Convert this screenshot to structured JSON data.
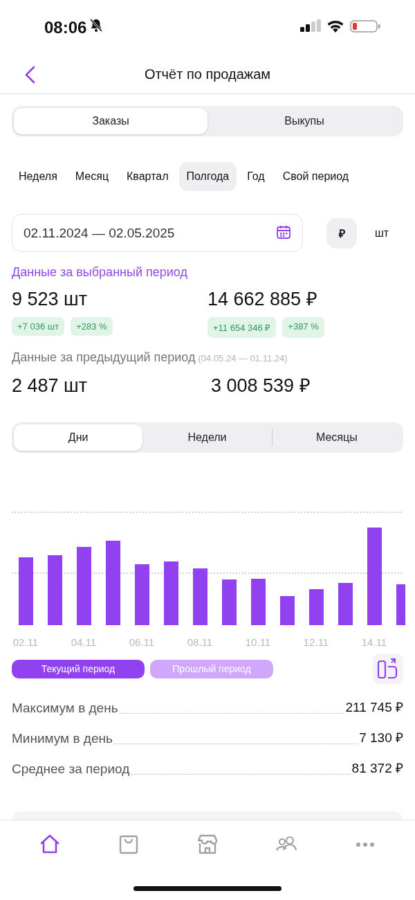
{
  "status_bar": {
    "time": "08:06"
  },
  "header": {
    "title": "Отчёт по продажам"
  },
  "mode_tabs": [
    {
      "label": "Заказы",
      "selected": true
    },
    {
      "label": "Выкупы",
      "selected": false
    }
  ],
  "periods": [
    {
      "label": "Неделя",
      "selected": false
    },
    {
      "label": "Месяц",
      "selected": false
    },
    {
      "label": "Квартал",
      "selected": false
    },
    {
      "label": "Полгода",
      "selected": true
    },
    {
      "label": "Год",
      "selected": false
    },
    {
      "label": "Свой период",
      "selected": false
    }
  ],
  "date_range": {
    "value": "02.11.2024 — 02.05.2025"
  },
  "units": [
    {
      "label": "₽",
      "selected": true
    },
    {
      "label": "шт",
      "selected": false
    }
  ],
  "current": {
    "title": "Данные за выбранный период",
    "items": [
      {
        "value": "9 523 шт",
        "badges": [
          "+7 036 шт",
          "+283 %"
        ]
      },
      {
        "value": "14 662 885 ₽",
        "badges": [
          "+11 654 346 ₽",
          "+387 %"
        ]
      }
    ]
  },
  "previous": {
    "title": "Данные за предыдущий период",
    "range": "(04.05.24 — 01.11.24)",
    "items": [
      {
        "value": "2 487 шт"
      },
      {
        "value": "3 008 539 ₽"
      }
    ]
  },
  "granularity_tabs": [
    {
      "label": "Дни",
      "selected": true
    },
    {
      "label": "Недели",
      "selected": false
    },
    {
      "label": "Месяцы",
      "selected": false
    }
  ],
  "chart": {
    "x_labels": [
      "02.11",
      "04.11",
      "06.11",
      "08.11",
      "10.11",
      "12.11",
      "14.11"
    ]
  },
  "legend": [
    {
      "label": "Текущий период",
      "color": "#9141f0"
    },
    {
      "label": "Прошлый период",
      "color": "#d0a7fb"
    }
  ],
  "stats": [
    {
      "label": "Максимум в день",
      "value": "211 745 ₽"
    },
    {
      "label": "Минимум в день",
      "value": "7 130 ₽"
    },
    {
      "label": "Среднее за период",
      "value": "81 372 ₽"
    }
  ],
  "bottom_nav": [
    {
      "kind": "home",
      "selected": true
    },
    {
      "kind": "bag",
      "selected": false
    },
    {
      "kind": "store",
      "selected": false
    },
    {
      "kind": "people",
      "selected": false
    },
    {
      "kind": "more",
      "selected": false
    }
  ]
}
